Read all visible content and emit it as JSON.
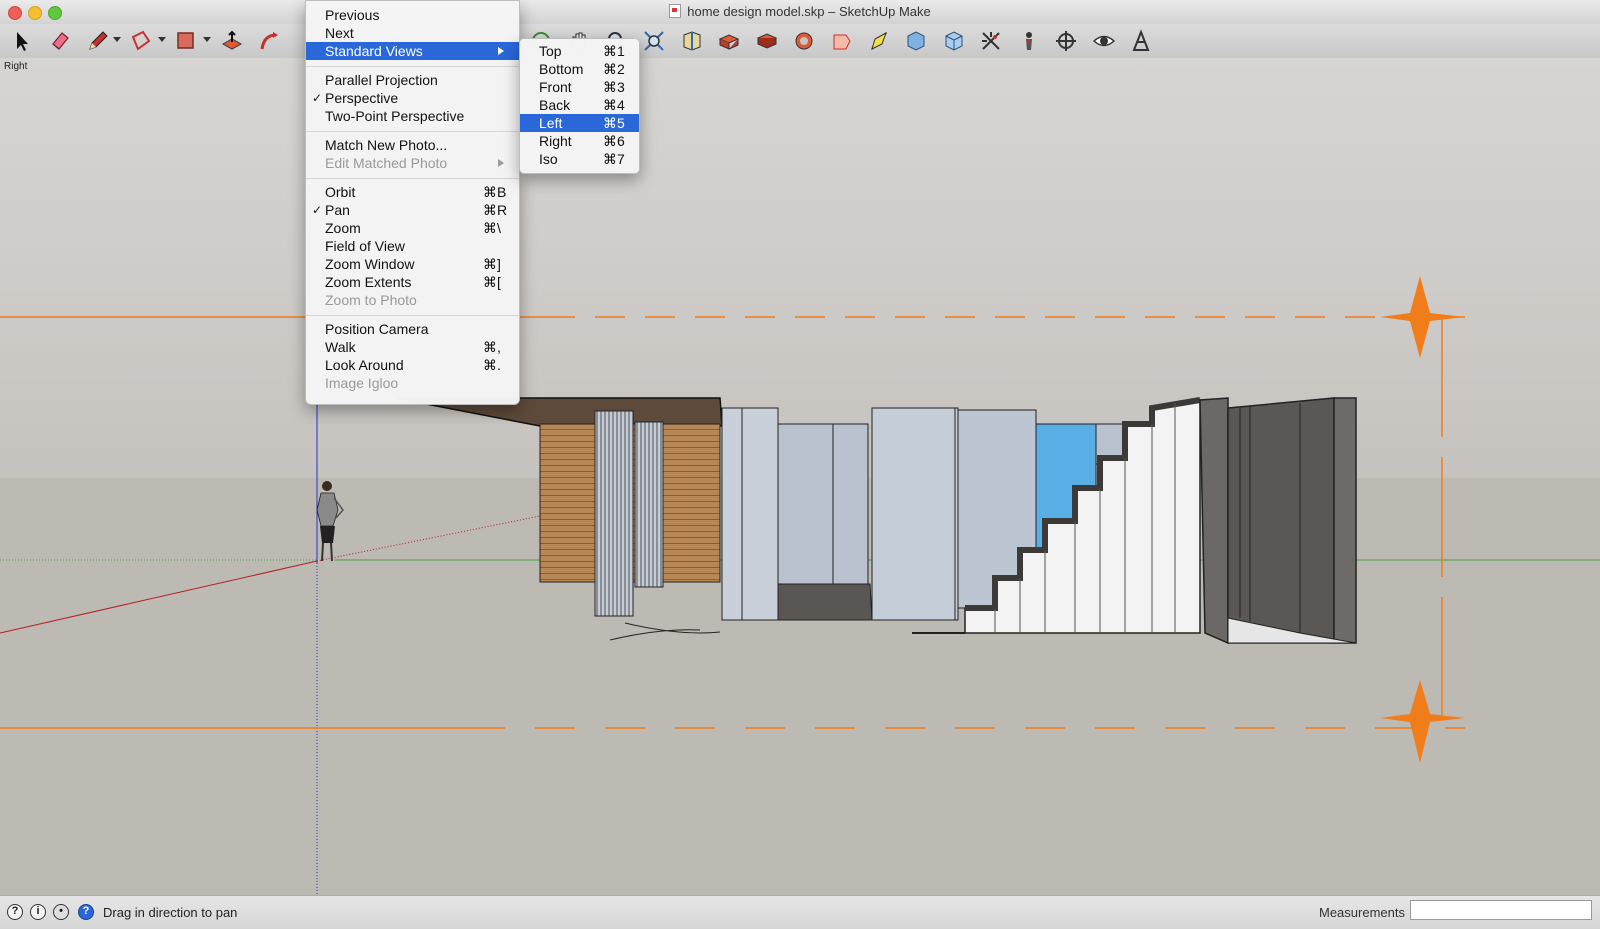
{
  "window": {
    "title": "home design model.skp – SketchUp Make"
  },
  "scene": {
    "label": "Right"
  },
  "toolbar": {
    "tools": [
      "select-tool",
      "eraser-tool",
      "pencil-tool",
      "shapes-tool",
      "rectangle-tool",
      "push-pull-tool",
      "follow-me-tool",
      "orbit-tool",
      "pan-tool",
      "zoom-tool",
      "zoom-extents-tool",
      "iso-view",
      "top-view",
      "front-view",
      "right-view",
      "back-view",
      "left-view",
      "bottom-view",
      "x-ray-tool",
      "section-plane-tool",
      "component-tool",
      "measure-tool",
      "position-camera-tool",
      "walk-tool",
      "look-around-tool",
      "warehouse-tool"
    ]
  },
  "camera_menu": {
    "items": [
      {
        "label": "Previous",
        "shortcut": "",
        "checked": false,
        "disabled": false,
        "submenu": false
      },
      {
        "label": "Next",
        "shortcut": "",
        "checked": false,
        "disabled": false,
        "submenu": false
      },
      {
        "label": "Standard Views",
        "shortcut": "",
        "checked": false,
        "disabled": false,
        "submenu": true,
        "highlighted": true
      },
      {
        "label": "Parallel Projection",
        "shortcut": "",
        "checked": false,
        "disabled": false,
        "submenu": false
      },
      {
        "label": "Perspective",
        "shortcut": "",
        "checked": true,
        "disabled": false,
        "submenu": false
      },
      {
        "label": "Two-Point Perspective",
        "shortcut": "",
        "checked": false,
        "disabled": false,
        "submenu": false
      },
      {
        "label": "Match New Photo...",
        "shortcut": "",
        "checked": false,
        "disabled": false,
        "submenu": false
      },
      {
        "label": "Edit Matched Photo",
        "shortcut": "",
        "checked": false,
        "disabled": true,
        "submenu": true
      },
      {
        "label": "Orbit",
        "shortcut": "⌘B",
        "checked": false,
        "disabled": false,
        "submenu": false
      },
      {
        "label": "Pan",
        "shortcut": "⌘R",
        "checked": true,
        "disabled": false,
        "submenu": false
      },
      {
        "label": "Zoom",
        "shortcut": "⌘\\",
        "checked": false,
        "disabled": false,
        "submenu": false
      },
      {
        "label": "Field of View",
        "shortcut": "",
        "checked": false,
        "disabled": false,
        "submenu": false
      },
      {
        "label": "Zoom Window",
        "shortcut": "⌘]",
        "checked": false,
        "disabled": false,
        "submenu": false
      },
      {
        "label": "Zoom Extents",
        "shortcut": "⌘[",
        "checked": false,
        "disabled": false,
        "submenu": false
      },
      {
        "label": "Zoom to Photo",
        "shortcut": "",
        "checked": false,
        "disabled": true,
        "submenu": false
      },
      {
        "label": "Position Camera",
        "shortcut": "",
        "checked": false,
        "disabled": false,
        "submenu": false
      },
      {
        "label": "Walk",
        "shortcut": "⌘,",
        "checked": false,
        "disabled": false,
        "submenu": false
      },
      {
        "label": "Look Around",
        "shortcut": "⌘.",
        "checked": false,
        "disabled": false,
        "submenu": false
      },
      {
        "label": "Image Igloo",
        "shortcut": "",
        "checked": false,
        "disabled": true,
        "submenu": false
      }
    ]
  },
  "standard_views_menu": {
    "items": [
      {
        "label": "Top",
        "shortcut": "⌘1"
      },
      {
        "label": "Bottom",
        "shortcut": "⌘2"
      },
      {
        "label": "Front",
        "shortcut": "⌘3"
      },
      {
        "label": "Back",
        "shortcut": "⌘4"
      },
      {
        "label": "Left",
        "shortcut": "⌘5",
        "highlighted": true
      },
      {
        "label": "Right",
        "shortcut": "⌘6"
      },
      {
        "label": "Iso",
        "shortcut": "⌘7"
      }
    ]
  },
  "statusbar": {
    "hint": "Drag in direction to pan",
    "measurements_label": "Measurements",
    "measurements_value": "",
    "icons": [
      "geolocation-icon",
      "credits-icon",
      "user-icon",
      "help-icon"
    ]
  },
  "colors": {
    "menu_highlight": "#2a67d8",
    "guide_orange": "#f07d1a",
    "sky": "#c9c6c1",
    "ground": "#bcb8b2",
    "window_blue": "#5aaee6"
  }
}
